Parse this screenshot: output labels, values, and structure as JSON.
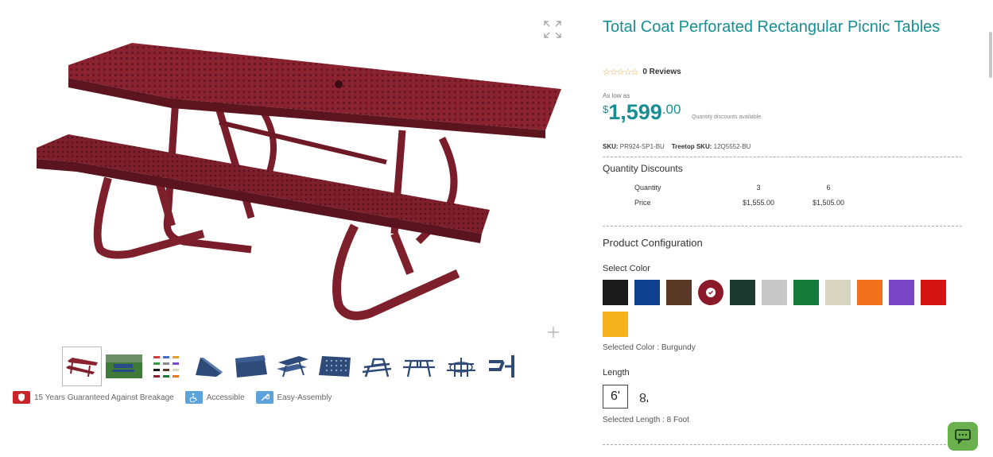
{
  "product": {
    "title": "Total Coat Perforated Rectangular Picnic Tables",
    "stars": "☆☆☆☆☆",
    "reviews_label": "0 Reviews",
    "as_low_as": "As low as",
    "price_currency": "$",
    "price_whole": "1,599",
    "price_cents": ".00",
    "quantity_note": "Quantity discounts available",
    "sku_label": "SKU:",
    "sku_value": "PR924-SP1-BU",
    "treetop_label": "Treetop SKU:",
    "treetop_value": "12Q5552-BU"
  },
  "quantity_discounts": {
    "heading": "Quantity Discounts",
    "row_labels": [
      "Quantity",
      "Price"
    ],
    "quantities": [
      "3",
      "6"
    ],
    "prices": [
      "$1,555.00",
      "$1,505.00"
    ]
  },
  "configuration": {
    "heading": "Product Configuration",
    "select_color_label": "Select Color",
    "colors": [
      "#1b1b1b",
      "#0f3f8f",
      "#5a3a26",
      "#8a1a2a",
      "#1e3a30",
      "#c8c8c8",
      "#137a3a",
      "#d8d6c0",
      "#f2711c",
      "#7a46c8",
      "#d71414",
      "#f5b21e"
    ],
    "selected_color_index": 3,
    "selected_color_text": "Selected Color : Burgundy",
    "length_label": "Length",
    "lengths": [
      "6'",
      "8'"
    ],
    "selected_length_text": "Selected Length : 8 Foot"
  },
  "features": [
    {
      "label": "15 Years Guaranteed Against Breakage",
      "color": "#c8252b"
    },
    {
      "label": "Accessible",
      "color": "#5aa3dc"
    },
    {
      "label": "Easy-Assembly",
      "color": "#5aa3dc"
    }
  ],
  "gallery": {
    "thumbnail_count": 11,
    "active_thumbnail": 0
  },
  "colors": {
    "accent": "#168f94",
    "product": "#7e1f2c",
    "chat": "#6ab04c"
  }
}
